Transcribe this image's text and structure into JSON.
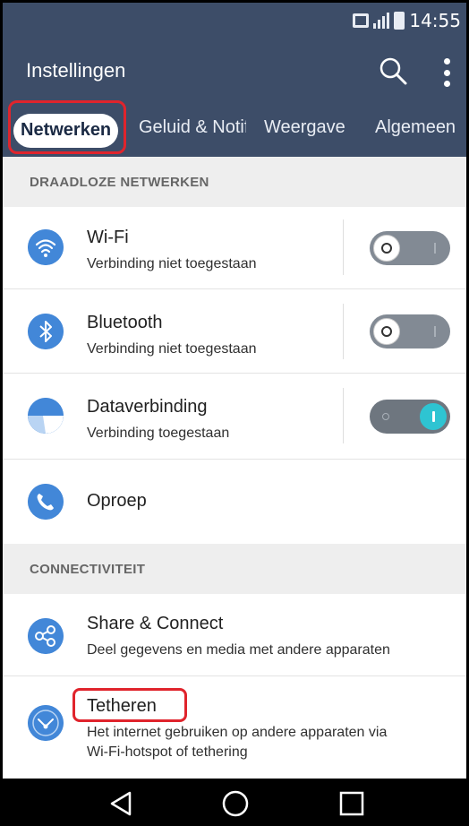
{
  "status_bar": {
    "time": "14:55",
    "icons": [
      "sim-icon",
      "signal-icon",
      "battery-icon"
    ]
  },
  "app_bar": {
    "title": "Instellingen",
    "actions": [
      "search-icon",
      "more-vert-icon"
    ]
  },
  "tabs": [
    {
      "label": "Netwerken",
      "active": true
    },
    {
      "label": "Geluid & Notificaties",
      "active": false
    },
    {
      "label": "Weergave",
      "active": false
    },
    {
      "label": "Algemeen",
      "active": false
    }
  ],
  "sections": {
    "wireless": {
      "header": "DRAADLOZE NETWERKEN",
      "items": [
        {
          "title": "Wi-Fi",
          "subtitle": "Verbinding niet toegestaan",
          "icon": "wifi-icon",
          "toggle": "off"
        },
        {
          "title": "Bluetooth",
          "subtitle": "Verbinding niet toegestaan",
          "icon": "bluetooth-icon",
          "toggle": "off"
        },
        {
          "title": "Dataverbinding",
          "subtitle": "Verbinding toegestaan",
          "icon": "data-connection-icon",
          "toggle": "on"
        },
        {
          "title": "Oproep",
          "icon": "phone-icon"
        }
      ]
    },
    "connectivity": {
      "header": "CONNECTIVITEIT",
      "items": [
        {
          "title": "Share & Connect",
          "subtitle": "Deel gegevens en media met andere apparaten",
          "icon": "share-connect-icon"
        },
        {
          "title": "Tetheren",
          "subtitle_line1": "Het internet gebruiken op andere apparaten via",
          "subtitle_line2": "Wi-Fi-hotspot of tethering",
          "icon": "tethering-icon"
        }
      ]
    }
  },
  "nav_bar": {
    "buttons": [
      "back-icon",
      "home-icon",
      "recents-icon"
    ]
  },
  "colors": {
    "header_bg": "#3d4d68",
    "icon_blue": "#4287d8",
    "toggle_on": "#2ec4d2",
    "highlight": "#e0242c"
  }
}
